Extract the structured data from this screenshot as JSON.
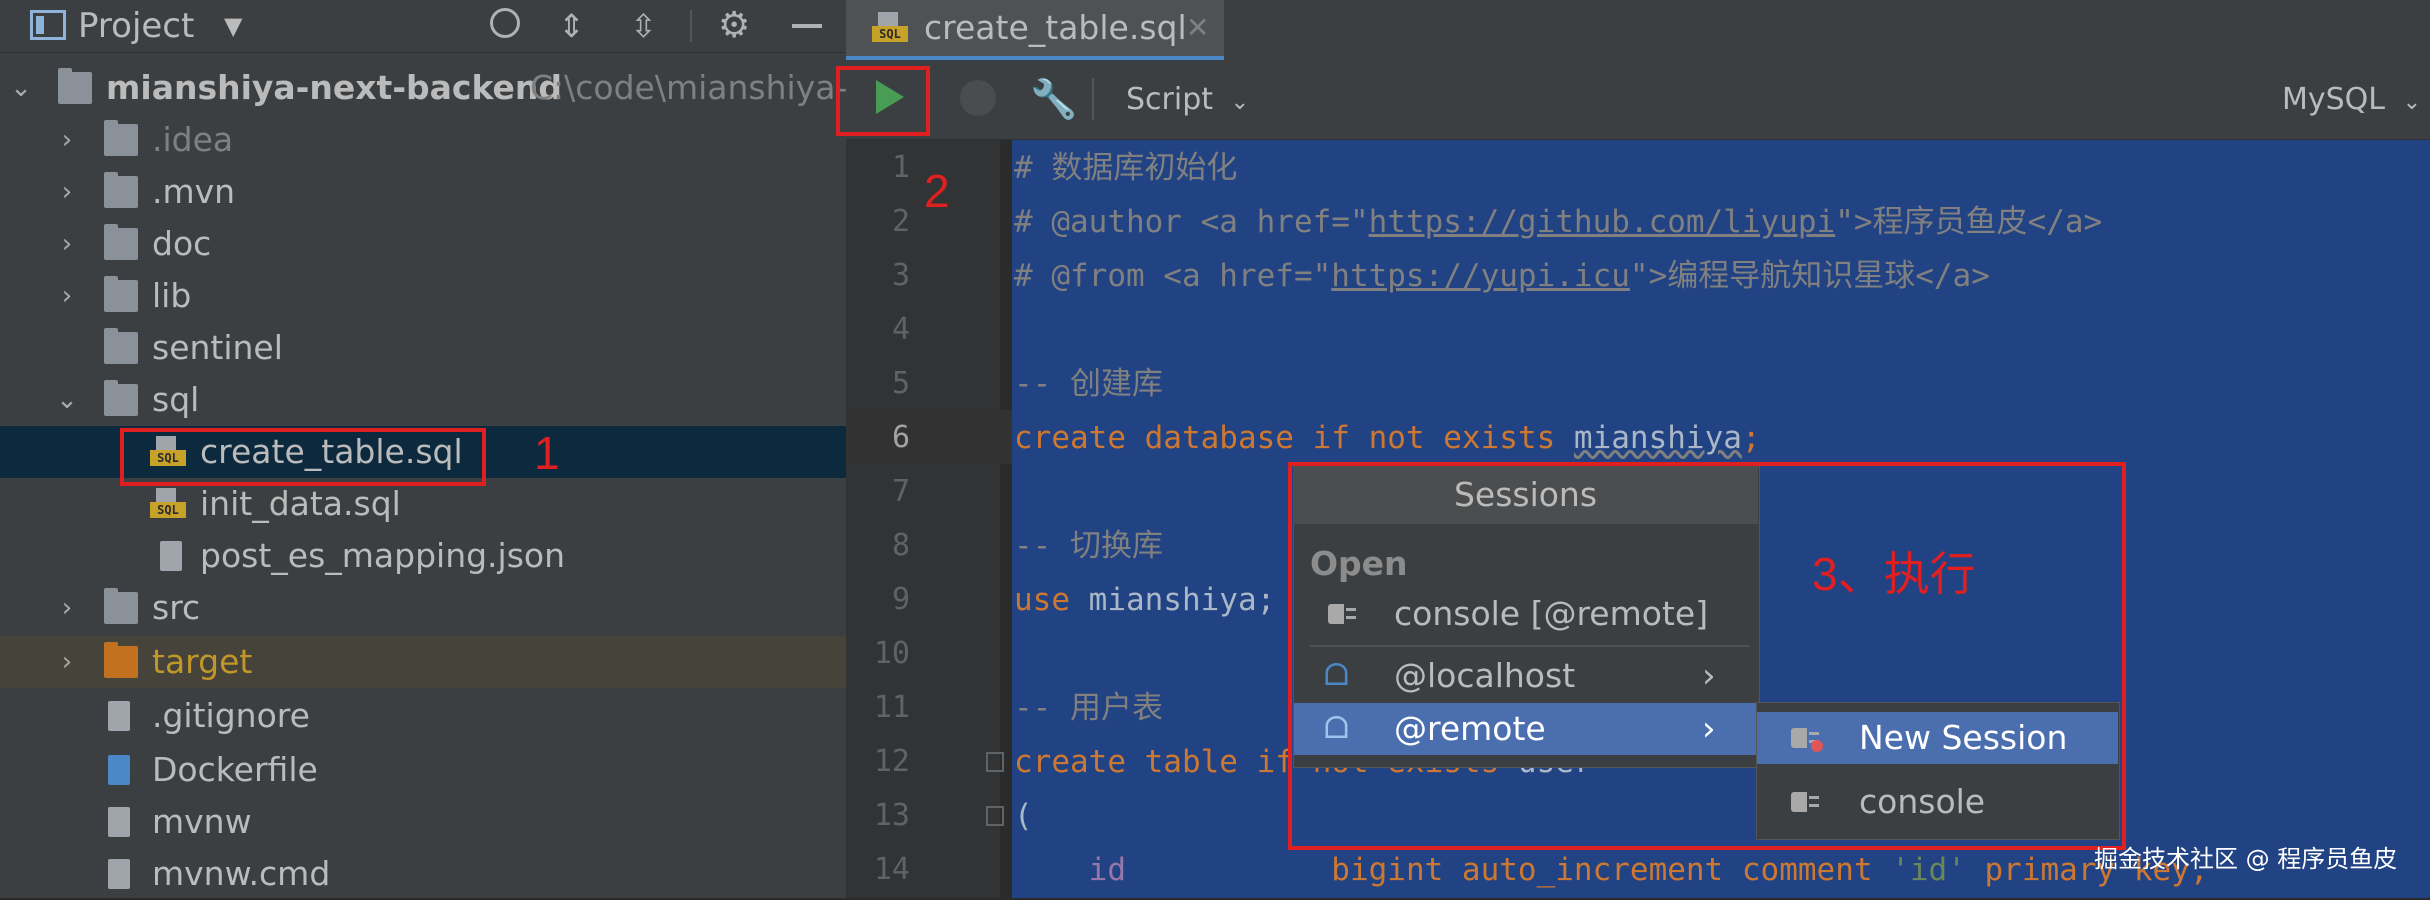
{
  "project": {
    "title": "Project",
    "root_name": "mianshiya-next-backend",
    "root_path": "C:\\code\\mianshiya-r",
    "items": [
      {
        "label": ".idea"
      },
      {
        "label": ".mvn"
      },
      {
        "label": "doc"
      },
      {
        "label": "lib"
      },
      {
        "label": "sentinel"
      },
      {
        "label": "sql"
      },
      {
        "label": "create_table.sql"
      },
      {
        "label": "init_data.sql"
      },
      {
        "label": "post_es_mapping.json"
      },
      {
        "label": "src"
      },
      {
        "label": "target"
      },
      {
        "label": ".gitignore"
      },
      {
        "label": "Dockerfile"
      },
      {
        "label": "mvnw"
      },
      {
        "label": "mvnw.cmd"
      }
    ]
  },
  "editor": {
    "tab_label": "create_table.sql",
    "script_label": "Script",
    "dialect_label": "MySQL",
    "line_numbers": [
      "1",
      "2",
      "3",
      "4",
      "5",
      "6",
      "7",
      "8",
      "9",
      "10",
      "11",
      "12",
      "13",
      "14"
    ],
    "lines": {
      "l1": "# 数据库初始化",
      "l2a": "# @author <a href=\"",
      "l2b": "https://github.com/liyupi",
      "l2c": "\">程序员鱼皮</a>",
      "l3a": "# @from <a href=\"",
      "l3b": "https://yupi.icu",
      "l3c": "\">编程导航知识星球</a>",
      "l5": "-- 创建库",
      "l6a": "create database if not exists ",
      "l6b": "mianshiya",
      "l6c": ";",
      "l8": "-- 切换库",
      "l9a": "use ",
      "l9b": "mianshiya;",
      "l11": "-- 用户表",
      "l12a": "create table if not exists ",
      "l12b": "user",
      "l13": "(",
      "l14a": "    id",
      "l14b": "           bigint auto_increment comment ",
      "l14c": "'id'",
      "l14d": " primary key,"
    }
  },
  "popup": {
    "title": "Sessions",
    "section_label": "Open",
    "items": {
      "console_remote": "console [@remote]",
      "localhost": "@localhost",
      "remote": "@remote"
    },
    "submenu": {
      "new_session": "New Session",
      "console": "console"
    }
  },
  "annotations": {
    "one": "1",
    "two": "2",
    "three": "3、执行"
  },
  "watermark": "掘金技术社区 @ 程序员鱼皮",
  "colors": {
    "accent": "#4a88c7",
    "selection": "#214283",
    "annotation_red": "#e02020",
    "keyword": "#cc7832",
    "run_green": "#499c54"
  }
}
